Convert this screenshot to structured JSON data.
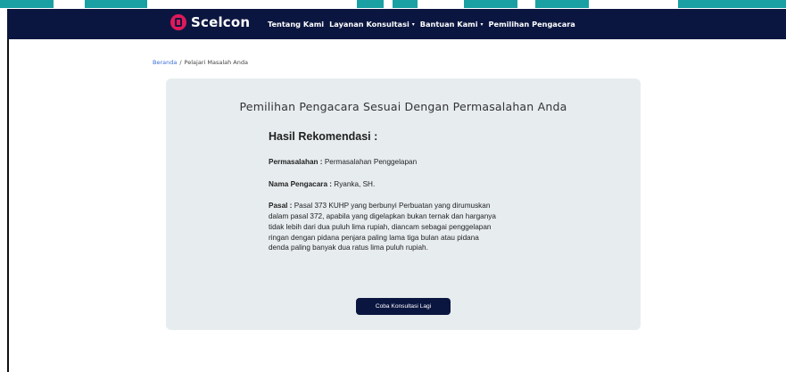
{
  "navbar": {
    "brand": "Scelcon",
    "items": [
      {
        "label": "Tentang Kami",
        "has_caret": false
      },
      {
        "label": "Layanan Konsultasi",
        "has_caret": true
      },
      {
        "label": "Bantuan Kami",
        "has_caret": true
      },
      {
        "label": "Pemilihan Pengacara",
        "has_caret": false
      }
    ],
    "caret_icon": "chevron-down-icon"
  },
  "breadcrumb": {
    "home": "Beranda",
    "separator": "/",
    "current": "Pelajari Masalah Anda"
  },
  "card": {
    "title": "Pemilihan Pengacara Sesuai Dengan Permasalahan Anda",
    "heading": "Hasil Rekomendasi :",
    "problem_label": "Permasalahan :",
    "problem_value": "Permasalahan Penggelapan",
    "lawyer_label": "Nama Pengacara :",
    "lawyer_value": "Ryanka, SH.",
    "article_label": "Pasal :",
    "article_value": "Pasal 373 KUHP yang berbunyi Perbuatan yang dirumuskan dalam pasal 372, apabila yang digelapkan bukan ternak dan harganya tidak lebih dari dua puluh lima rupiah, diancam sebagai penggelapan ringan dengan pidana penjara paling lama tiga bulan atau pidana denda paling banyak dua ratus lima puluh rupiah.",
    "retry_button": "Coba Konsultasi Lagi"
  },
  "colors": {
    "navbar_bg": "#0b1640",
    "brand_accent": "#e0195a",
    "card_bg": "#e7ecef",
    "link": "#3b6fd8",
    "watermark": "#1aa0a3"
  }
}
